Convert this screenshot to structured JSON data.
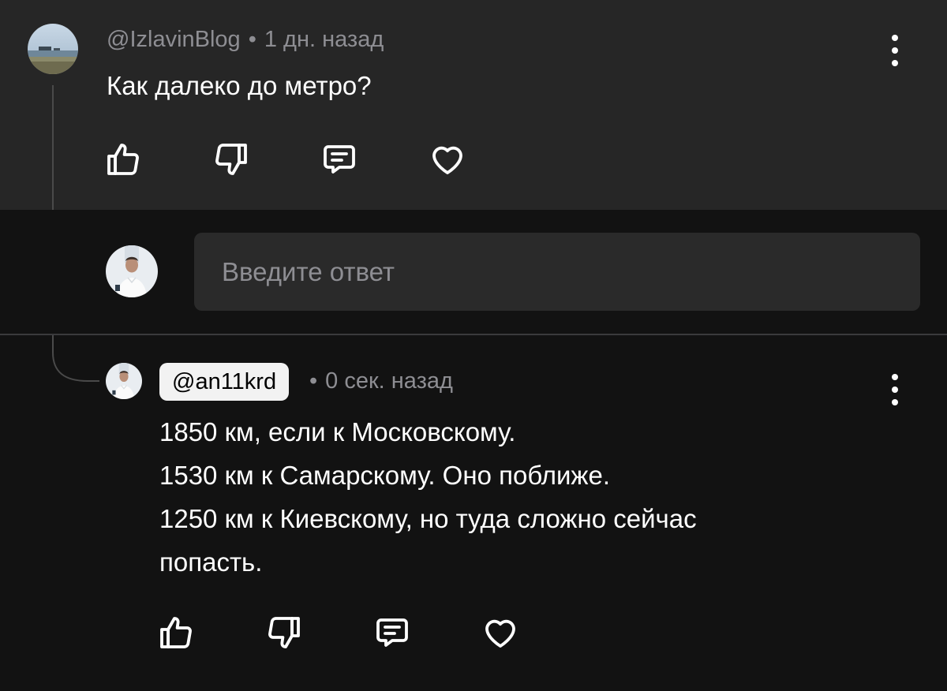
{
  "comment": {
    "author": "@IzlavinBlog",
    "separator": "•",
    "time": "1 дн. назад",
    "text": "Как далеко до метро?"
  },
  "reply_input": {
    "placeholder": "Введите ответ"
  },
  "reply": {
    "author": "@an11krd",
    "separator": "•",
    "time": "0 сек. назад",
    "lines": [
      "1850 км, если к Московскому.",
      "1530 км к Самарскому. Оно поближе.",
      "1250 км к Киевскому, но туда сложно сейчас",
      "попасть."
    ]
  },
  "icons": {
    "like": "thumbs-up-icon",
    "dislike": "thumbs-down-icon",
    "reply": "comment-icon",
    "favorite": "heart-icon",
    "menu": "more-vertical-icon"
  },
  "colors": {
    "background": "#121212",
    "comment_background": "#262626",
    "input_background": "#2a2a2a",
    "secondary_text": "#8e8e93",
    "badge_background": "#f2f2f2"
  }
}
